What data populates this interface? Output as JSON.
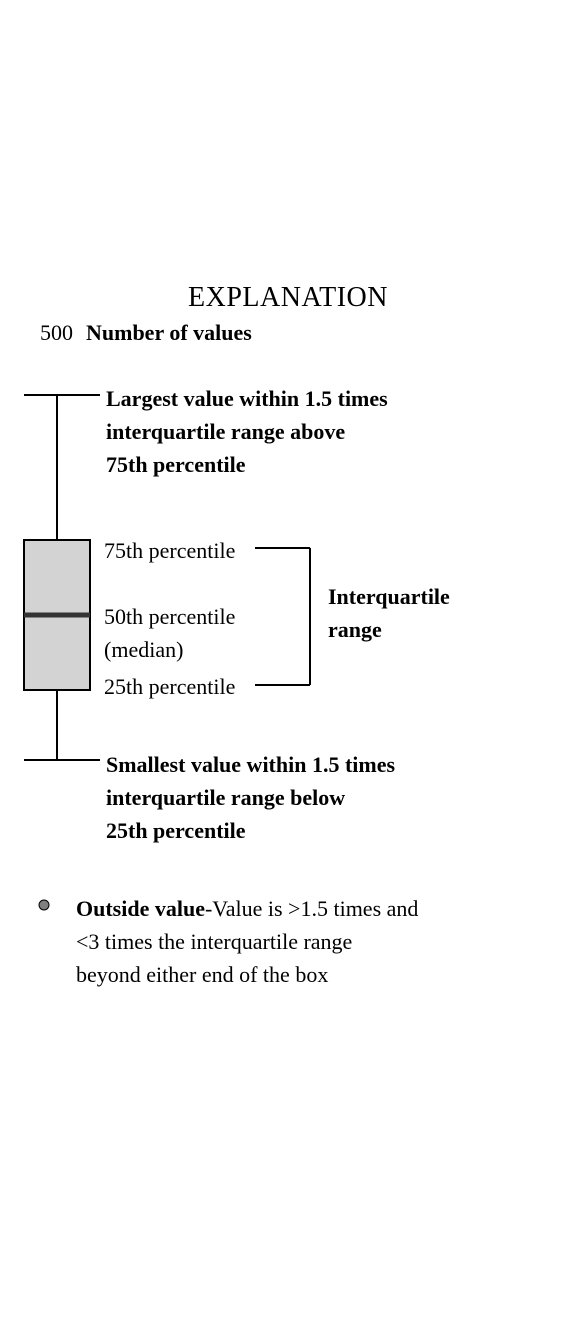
{
  "title": "EXPLANATION",
  "count": "500",
  "count_label": "Number of values",
  "top_whisker_l1": "Largest value within 1.5 times",
  "top_whisker_l2": "interquartile range above",
  "top_whisker_l3": "75th percentile",
  "p75": "75th percentile",
  "p50_a": "50th percentile",
  "p50_b": "(median)",
  "p25": "25th percentile",
  "iqr_l1": "Interquartile",
  "iqr_l2": "range",
  "bot_whisker_l1": "Smallest value within 1.5 times",
  "bot_whisker_l2": "interquartile range below",
  "bot_whisker_l3": "25th percentile",
  "outside_bold": "Outside value",
  "outside_rest_a": "-Value is >1.5 times and",
  "outside_l2": "<3 times the interquartile range",
  "outside_l3": "beyond either end of the box"
}
